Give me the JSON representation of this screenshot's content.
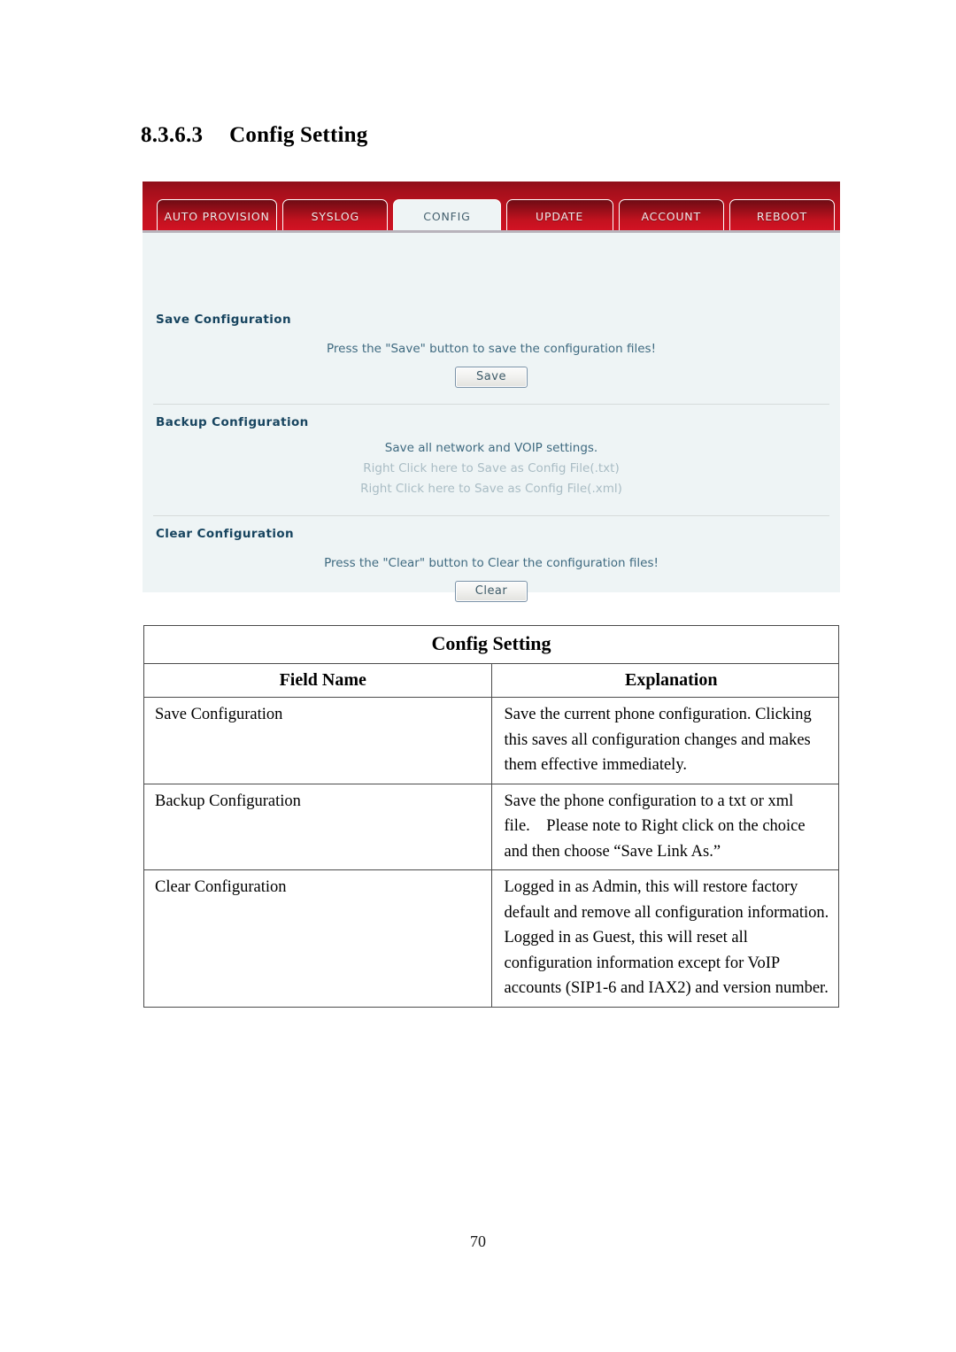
{
  "heading": {
    "number": "8.3.6.3",
    "title": "Config Setting"
  },
  "webui": {
    "tabs": [
      {
        "label": "AUTO PROVISION",
        "active": false
      },
      {
        "label": "SYSLOG",
        "active": false
      },
      {
        "label": "CONFIG",
        "active": true
      },
      {
        "label": "UPDATE",
        "active": false
      },
      {
        "label": "ACCOUNT",
        "active": false
      },
      {
        "label": "REBOOT",
        "active": false
      }
    ],
    "groups": {
      "save": {
        "title": "Save Configuration",
        "description": "Press the \"Save\" button to save the configuration files!",
        "button": "Save"
      },
      "backup": {
        "title": "Backup Configuration",
        "description": "Save all network and VOIP settings.",
        "link_txt": "Right Click here to Save as Config File(.txt)",
        "link_xml": "Right Click here to Save as Config File(.xml)"
      },
      "clear": {
        "title": "Clear Configuration",
        "description": "Press the \"Clear\" button to Clear the configuration files!",
        "button": "Clear"
      }
    },
    "colors": {
      "tabbar_red": "#c0121f",
      "panel_bg": "#eef4f5",
      "title_blue": "#17445f",
      "active_tab_text": "#44606e"
    }
  },
  "table": {
    "title": "Config Setting",
    "headers": [
      "Field Name",
      "Explanation"
    ],
    "rows": [
      {
        "field": "Save Configuration",
        "explanation": "Save the current phone configuration. Clicking this saves all configuration changes and makes them effective immediately."
      },
      {
        "field": "Backup Configuration",
        "explanation": "Save the phone configuration to a txt or xml file. Please note to Right click on the choice and then choose “Save Link As.”"
      },
      {
        "field": "Clear Configuration",
        "explanation": "Logged in as Admin, this will restore factory default and remove all configuration information.\nLogged in as Guest, this will reset all configuration information except for VoIP accounts (SIP1-6 and IAX2) and version number."
      }
    ]
  },
  "footer": {
    "page_number": "70"
  }
}
